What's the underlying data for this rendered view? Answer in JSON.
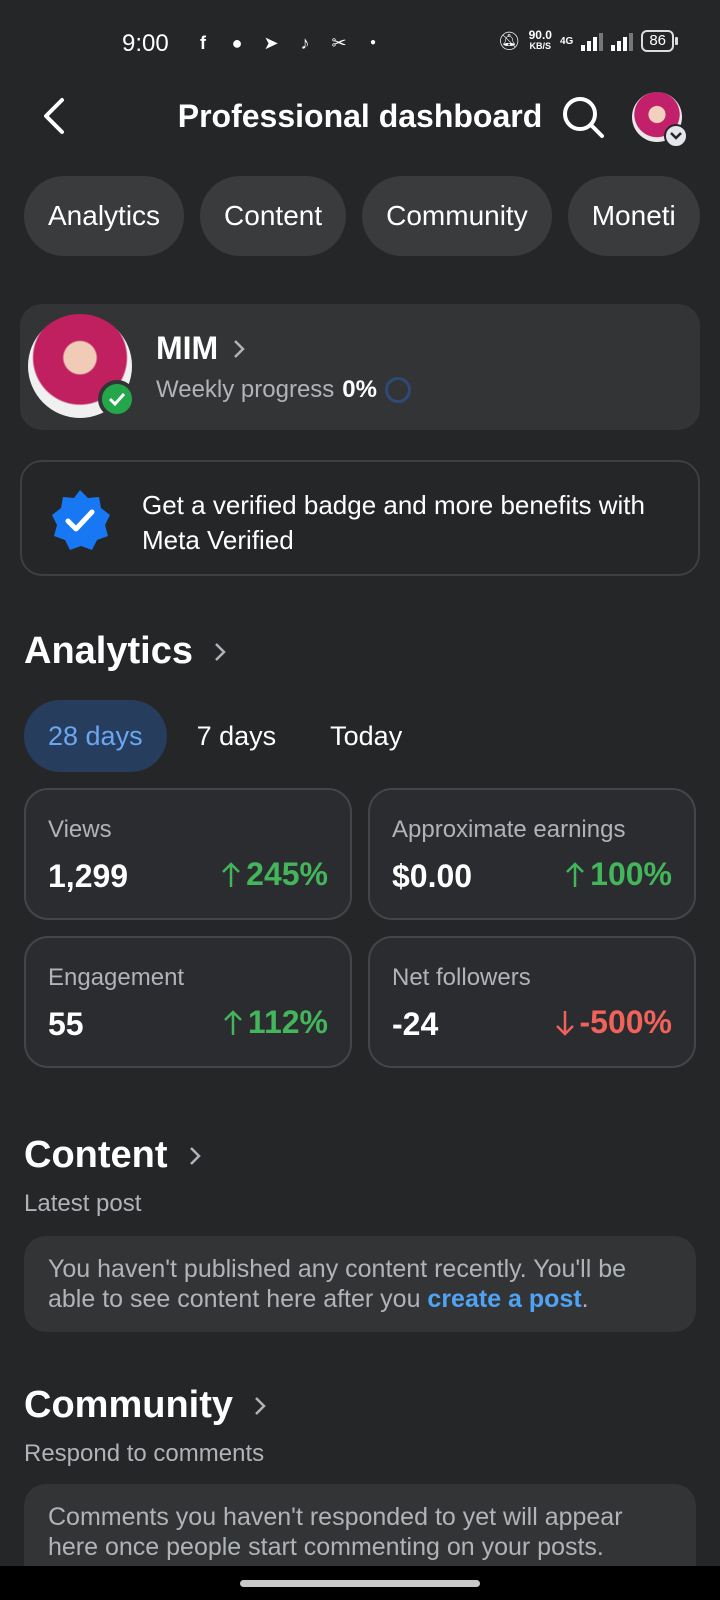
{
  "status_bar": {
    "time": "9:00",
    "speed_value": "90.0",
    "speed_unit": "KB/S",
    "network": "4G",
    "battery": "86"
  },
  "header": {
    "title": "Professional dashboard"
  },
  "tabs": [
    "Analytics",
    "Content",
    "Community",
    "Moneti"
  ],
  "profile": {
    "name": "MIM",
    "progress_label": "Weekly progress",
    "progress_value": "0%"
  },
  "verified_card": {
    "text": "Get a verified badge and more benefits with Meta Verified"
  },
  "analytics": {
    "title": "Analytics",
    "periods": [
      "28 days",
      "7 days",
      "Today"
    ],
    "metrics": [
      {
        "label": "Views",
        "value": "1,299",
        "change": "245%",
        "direction": "up"
      },
      {
        "label": "Approximate earnings",
        "value": "$0.00",
        "change": "100%",
        "direction": "up"
      },
      {
        "label": "Engagement",
        "value": "55",
        "change": "112%",
        "direction": "up"
      },
      {
        "label": "Net followers",
        "value": "-24",
        "change": "-500%",
        "direction": "down"
      }
    ]
  },
  "content": {
    "title": "Content",
    "subtitle": "Latest post",
    "text": "You haven't published any content recently. You'll be able to see content here after you ",
    "link": "create a post",
    "suffix": "."
  },
  "community": {
    "title": "Community",
    "subtitle": "Respond to comments",
    "text": "Comments you haven't responded to yet will appear here once people start commenting on your posts."
  },
  "colors": {
    "background": "#252628",
    "accent": "#4fa3f5",
    "positive": "#43b55b",
    "negative": "#f0625a"
  }
}
